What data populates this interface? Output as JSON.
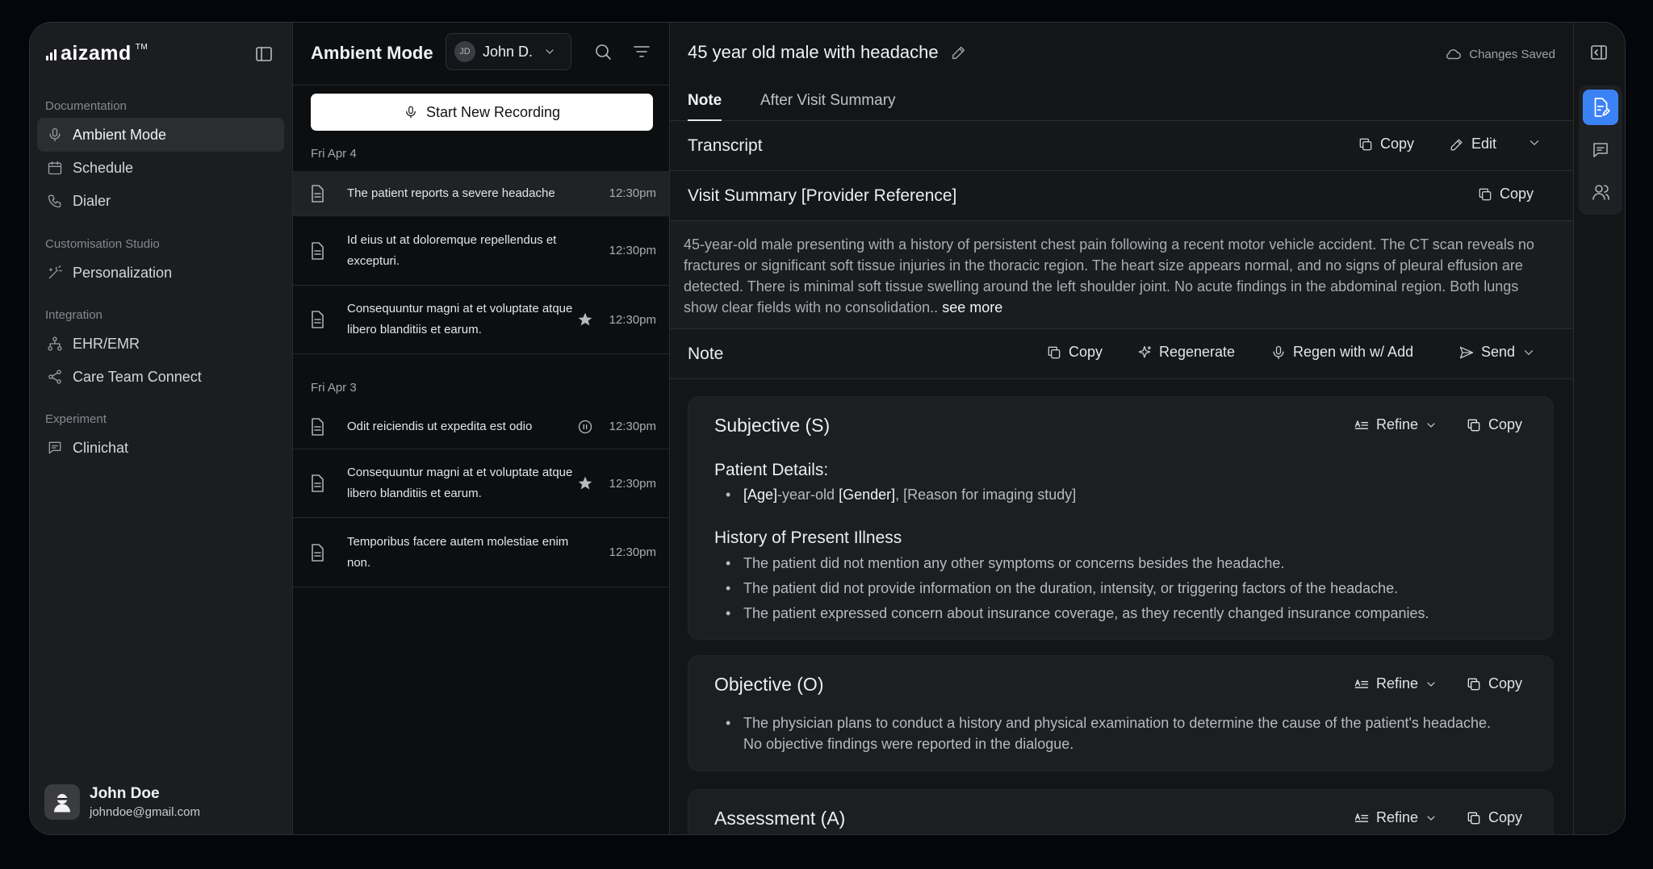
{
  "brand": {
    "name": "aizamd",
    "tm": "TM"
  },
  "sidebar": {
    "sections": [
      {
        "title": "Documentation"
      },
      {
        "title": "Customisation Studio"
      },
      {
        "title": "Integration"
      },
      {
        "title": "Experiment"
      }
    ],
    "items": [
      {
        "label": "Ambient Mode",
        "icon": "microphone-icon"
      },
      {
        "label": "Schedule",
        "icon": "calendar-icon"
      },
      {
        "label": "Dialer",
        "icon": "phone-icon"
      },
      {
        "label": "Personalization",
        "icon": "magic-wand-icon"
      },
      {
        "label": "EHR/EMR",
        "icon": "hierarchy-icon"
      },
      {
        "label": "Care Team Connect",
        "icon": "share-icon"
      },
      {
        "label": "Clinichat",
        "icon": "chat-icon"
      }
    ],
    "user": {
      "name": "John Doe",
      "email": "johndoe@gmail.com"
    }
  },
  "list": {
    "title": "Ambient Mode",
    "user_initials": "JD",
    "user_name": "John D.",
    "record_button": "Start New Recording",
    "groups": [
      {
        "date": "Fri Apr 4"
      },
      {
        "date": "Fri Apr 3"
      }
    ],
    "recordings": [
      {
        "text": "The patient reports a severe headache",
        "time": "12:30pm"
      },
      {
        "text": "Id eius ut at doloremque repellendus et excepturi.",
        "time": "12:30pm"
      },
      {
        "text": "Consequuntur magni at et voluptate atque libero blanditiis et earum.",
        "time": "12:30pm"
      },
      {
        "text": "Odit reiciendis ut expedita est odio",
        "time": "12:30pm"
      },
      {
        "text": "Consequuntur magni at et voluptate atque libero blanditiis et earum.",
        "time": "12:30pm"
      },
      {
        "text": "Temporibus facere autem molestiae enim non.",
        "time": "12:30pm"
      }
    ]
  },
  "main": {
    "title": "45 year old male with headache",
    "status": "Changes Saved",
    "tabs": [
      "Note",
      "After Visit Summary"
    ],
    "transcript": {
      "title": "Transcript",
      "copy": "Copy",
      "edit": "Edit"
    },
    "visit_summary": {
      "title": "Visit Summary [Provider Reference]",
      "copy": "Copy",
      "text": "45-year-old male presenting with a history of persistent chest pain following a recent motor vehicle accident. The CT scan reveals no fractures or significant soft tissue injuries in the thoracic region. The heart size appears normal, and no signs of pleural effusion are detected. There is minimal soft tissue swelling around the left shoulder joint. No acute findings in the abdominal region. Both lungs show clear fields with no consolidation..",
      "see_more": "see more"
    },
    "note": {
      "title": "Note",
      "copy": "Copy",
      "regenerate": "Regenerate",
      "regen_add": "Regen with w/ Add",
      "send": "Send"
    },
    "sections": {
      "refine": "Refine",
      "copy": "Copy",
      "subjective": {
        "title": "Subjective (S)",
        "patient_details_heading": "Patient Details:",
        "age": "[Age]",
        "age_suffix": "-year-old",
        "gender": "[Gender]",
        "reason": "[Reason for imaging study]",
        "hpi_heading": "History of Present Illness",
        "hpi": [
          "The patient did not mention any other symptoms or concerns besides the headache.",
          "The patient did not provide information on the duration, intensity, or triggering factors of the headache.",
          "The patient expressed concern about insurance coverage, as they recently changed insurance companies."
        ]
      },
      "objective": {
        "title": "Objective (O)",
        "text": "The physician plans to conduct a history and physical examination to determine the cause of the patient's headache. No objective findings were reported in the dialogue."
      },
      "assessment": {
        "title": "Assessment (A)"
      }
    }
  },
  "colors": {
    "accent": "#3b82f6",
    "background": "#04060c",
    "panel": "#1c1d20"
  }
}
